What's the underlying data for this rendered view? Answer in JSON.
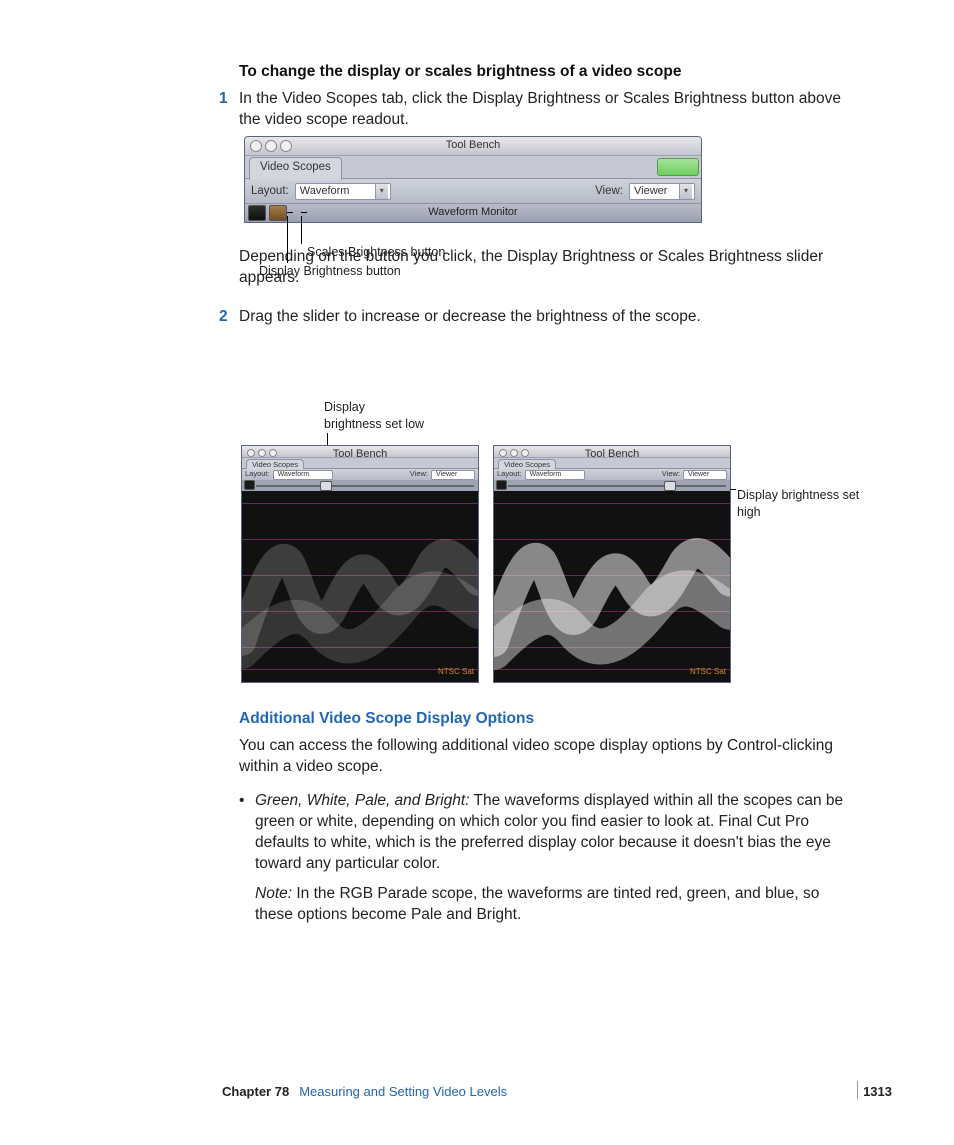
{
  "heading": "To change the display or scales brightness of a video scope",
  "step1": "In the Video Scopes tab, click the Display Brightness or Scales Brightness button above the video scope readout.",
  "step1_num": "1",
  "step2_num": "2",
  "para_after_fig1": "Depending on the button you click, the Display Brightness or Scales Brightness slider appears.",
  "step2": "Drag the slider to increase or decrease the brightness of the scope.",
  "fig1": {
    "title": "Tool Bench",
    "tab": "Video Scopes",
    "layout_label": "Layout:",
    "layout_value": "Waveform",
    "view_label": "View:",
    "view_value": "Viewer",
    "monitor_label": "Waveform Monitor",
    "callout_scales": "Scales Brightness button",
    "callout_display": "Display Brightness button"
  },
  "fig2": {
    "title": "Tool Bench",
    "tab": "Video Scopes",
    "layout_label": "Layout:",
    "layout_value": "Waveform",
    "view_label": "View:",
    "view_value": "Viewer",
    "sat": "NTSC Sat",
    "callout_low": "Display brightness set low",
    "callout_high": "Display brightness set high"
  },
  "section_heading": "Additional Video Scope Display Options",
  "section_para": "You can access the following additional video scope display options by Control-clicking within a video scope.",
  "bullet_lead": "Green, White, Pale, and Bright:",
  "bullet_text": "  The waveforms displayed within all the scopes can be green or white, depending on which color you find easier to look at. Final Cut Pro defaults to white, which is the preferred display color because it doesn't bias the eye toward any particular color.",
  "note_lead": "Note:",
  "note_text": "  In the RGB Parade scope, the waveforms are tinted red, green, and blue, so these options become Pale and Bright.",
  "footer": {
    "chapter_label": "Chapter 78",
    "chapter_title": "Measuring and Setting Video Levels",
    "page": "1313"
  }
}
